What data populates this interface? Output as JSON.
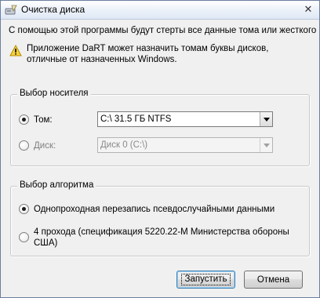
{
  "window": {
    "title": "Очистка диска",
    "close_glyph": "✕"
  },
  "description": "С помощью этой программы будут стерты все данные тома или жесткого",
  "warning": {
    "line1": "Приложение DaRT может назначить томам буквы дисков,",
    "line2": "отличные от назначенных Windows."
  },
  "media_group": {
    "legend": "Выбор носителя",
    "volume": {
      "label": "Том:",
      "selected": true,
      "value": "C:\\  31.5 ГБ NTFS"
    },
    "disk": {
      "label": "Диск:",
      "selected": false,
      "value": "Диск 0 (C:\\)",
      "enabled": false
    }
  },
  "algorithm_group": {
    "legend": "Выбор алгоритма",
    "options": [
      {
        "label": "Однопроходная перезапись псевдослучайными данными",
        "selected": true
      },
      {
        "label_line1": "4 прохода (спецификация 5220.22-М Министерства обороны",
        "label_line2": "США)",
        "selected": false
      }
    ]
  },
  "buttons": {
    "start": "Запустить",
    "cancel": "Отмена"
  },
  "icons": {
    "app": "disk-eraser-icon",
    "warning": "warning-icon",
    "close": "close-icon",
    "dropdown": "chevron-down-icon"
  }
}
